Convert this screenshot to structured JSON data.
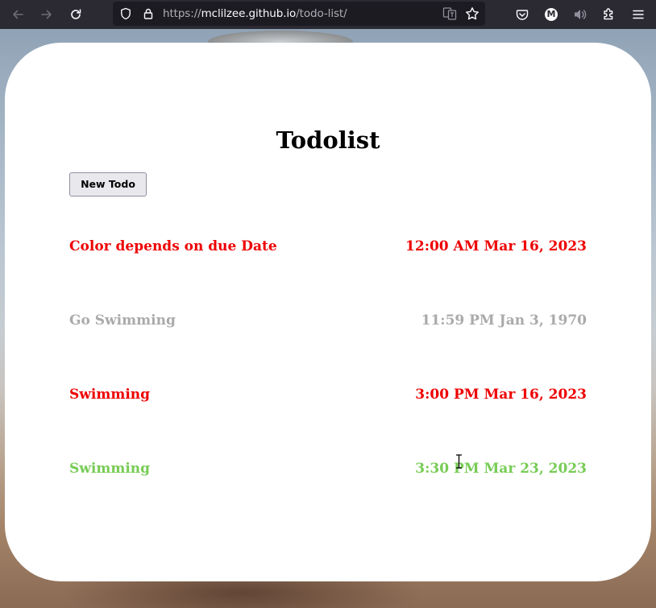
{
  "browser": {
    "url_prefix": "https://",
    "url_domain": "mclilzee.github.io",
    "url_path": "/todo-list/",
    "icons": {
      "back": "arrow-left-icon",
      "forward": "arrow-right-icon",
      "reload": "reload-icon",
      "tracking": "shield-icon",
      "lock": "lock-icon",
      "translate": "translate-icon",
      "bookmark": "star-icon",
      "pocket": "pocket-icon",
      "account": "account-icon",
      "sound": "speaker-icon",
      "extensions": "puzzle-icon",
      "menu": "hamburger-menu-icon"
    },
    "account_letter": "M"
  },
  "page": {
    "title": "Todolist",
    "new_todo_label": "New Todo"
  },
  "todos": [
    {
      "name": "Color depends on due Date",
      "due": "12:00 AM Mar 16, 2023",
      "color": "#ee0000"
    },
    {
      "name": "Go Swimming",
      "due": "11:59 PM Jan 3, 1970",
      "color": "#aaaaaa"
    },
    {
      "name": "Swimming",
      "due": "3:00 PM Mar 16, 2023",
      "color": "#ee0000"
    },
    {
      "name": "Swimming",
      "due": "3:30 PM Mar 23, 2023",
      "color": "#77cc55"
    }
  ],
  "colors": {
    "toolbar_bg": "#2b2a33",
    "urlbar_bg": "#1c1b22",
    "card_bg": "#ffffff",
    "overdue": "#ee0000",
    "past": "#aaaaaa",
    "upcoming": "#77cc55"
  }
}
